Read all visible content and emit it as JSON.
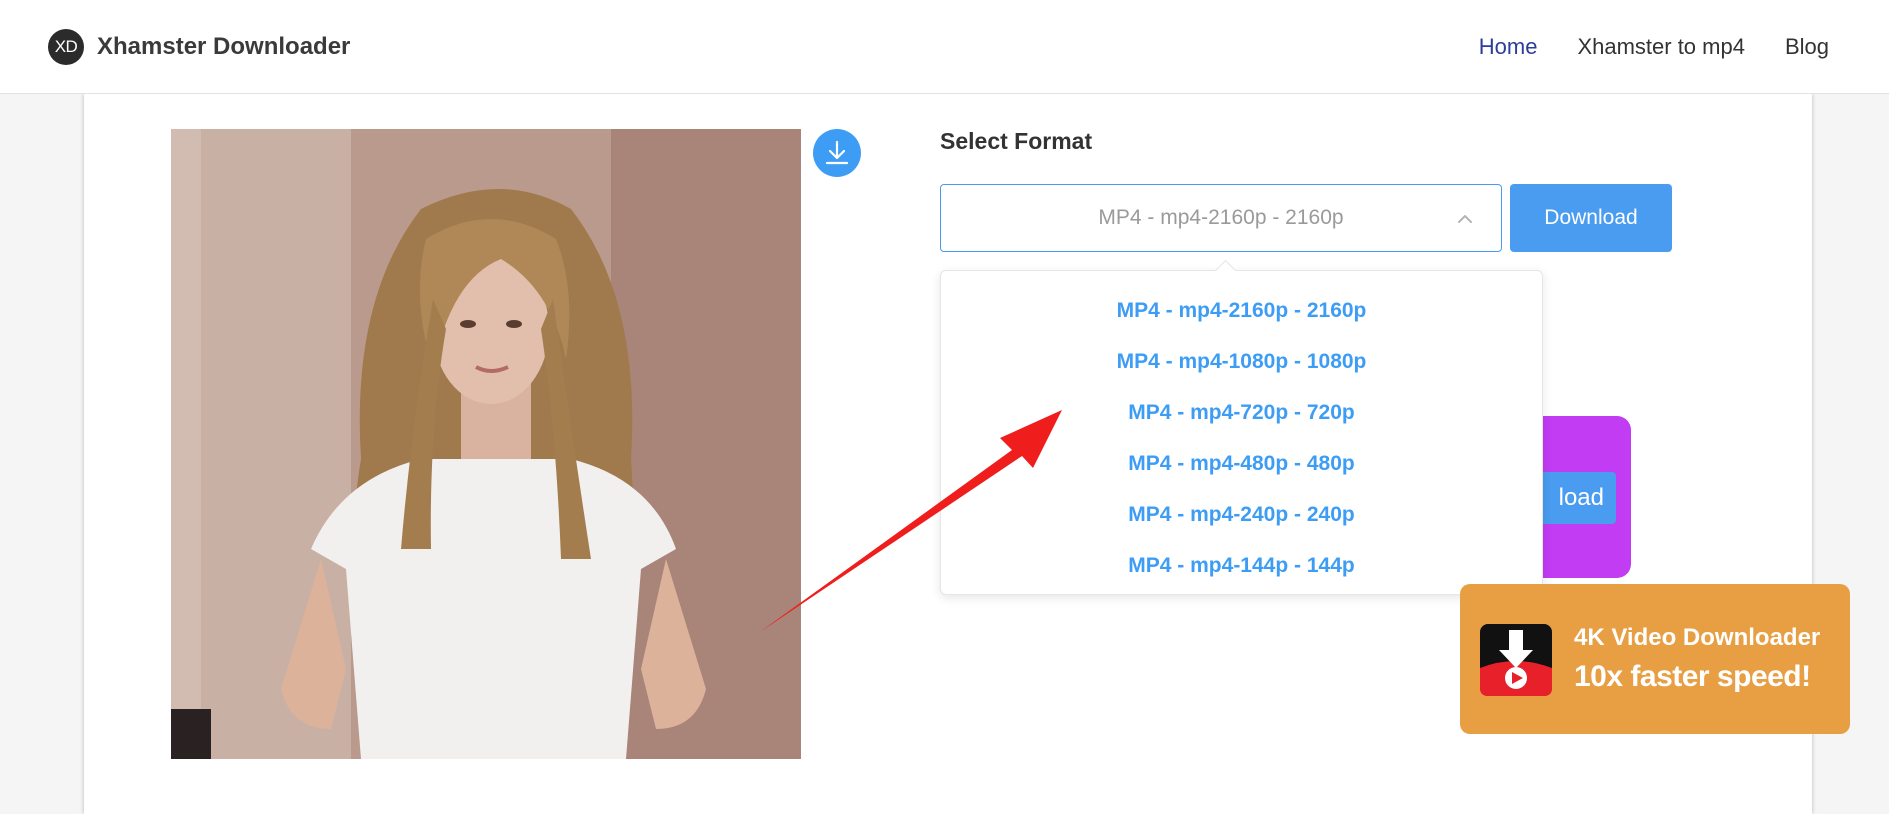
{
  "header": {
    "logo_text": "XD",
    "brand": "Xhamster Downloader",
    "nav": [
      {
        "label": "Home",
        "active": true
      },
      {
        "label": "Xhamster to mp4",
        "active": false
      },
      {
        "label": "Blog",
        "active": false
      }
    ]
  },
  "main": {
    "select_label": "Select Format",
    "selected_format": "MP4 - mp4-2160p - 2160p",
    "download_label": "Download",
    "options": [
      "MP4 - mp4-2160p - 2160p",
      "MP4 - mp4-1080p - 1080p",
      "MP4 - mp4-720p - 720p",
      "MP4 - mp4-480p - 480p",
      "MP4 - mp4-240p - 240p",
      "MP4 - mp4-144p - 144p"
    ],
    "popup_button_label": "load"
  },
  "ad": {
    "title": "4K Video Downloader",
    "subtitle": "10x faster speed!"
  },
  "colors": {
    "accent": "#4a9cf0",
    "nav_active": "#2c3e9a",
    "popup": "#c13cf2",
    "ad": "#e89f44",
    "arrow": "#f01d1d"
  },
  "icons": [
    "download-circle-icon",
    "chevron-up-icon",
    "red-arrow-annotation",
    "4k-downloader-app-icon"
  ]
}
